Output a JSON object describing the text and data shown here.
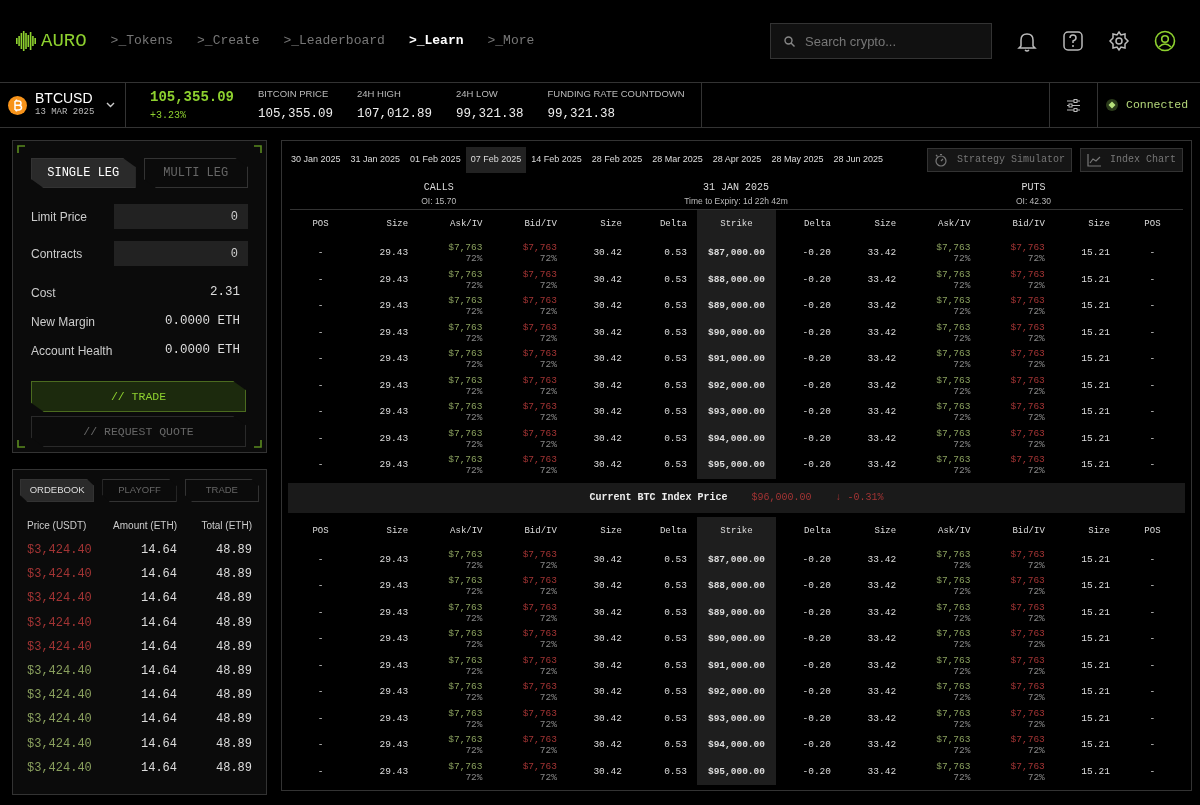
{
  "brand": {
    "name": "AURO"
  },
  "nav": [
    {
      "label": ">_Tokens",
      "selected": false
    },
    {
      "label": ">_Create",
      "selected": false
    },
    {
      "label": ">_Leaderboard",
      "selected": false
    },
    {
      "label": ">_Learn",
      "selected": true
    },
    {
      "label": ">_More",
      "selected": false
    }
  ],
  "search": {
    "placeholder": "Search crypto..."
  },
  "ticker": {
    "symbol": "BTCUSD",
    "date": "13 MAR 2025",
    "price": "105,355.09",
    "change": "+3.23%",
    "stats": [
      {
        "label": "BITCOIN PRICE",
        "value": "105,355.09"
      },
      {
        "label": "24H HIGH",
        "value": "107,012.89"
      },
      {
        "label": "24H LOW",
        "value": "99,321.38"
      },
      {
        "label": "FUNDING RATE COUNTDOWN",
        "value": "99,321.38"
      }
    ]
  },
  "connection": {
    "label": "Connected",
    "connected": true
  },
  "order_form": {
    "modes": [
      {
        "label": "SINGLE LEG",
        "selected": true
      },
      {
        "label": "MULTI LEG",
        "selected": false
      }
    ],
    "inputs": [
      {
        "label": "Limit Price",
        "value": "0"
      },
      {
        "label": "Contracts",
        "value": "0"
      }
    ],
    "summary": [
      {
        "label": "Cost",
        "value": "2.31"
      },
      {
        "label": "New Margin",
        "value": "0.0000 ETH"
      },
      {
        "label": "Account Health",
        "value": "0.0000 ETH"
      }
    ],
    "buttons": [
      {
        "label": "// TRADE",
        "kind": "primary"
      },
      {
        "label": "// REQUEST QUOTE",
        "kind": "secondary"
      }
    ]
  },
  "orderbook": {
    "tabs": [
      {
        "label": "ORDEBOOK",
        "selected": true
      },
      {
        "label": "PLAYOFF",
        "selected": false
      },
      {
        "label": "TRADE",
        "selected": false
      }
    ],
    "columns": [
      "Price (USDT)",
      "Amount (ETH)",
      "Total (ETH)"
    ],
    "rows": [
      {
        "price": "$3,424.40",
        "amount": "14.64",
        "total": "48.89",
        "color": "#a33434"
      },
      {
        "price": "$3,424.40",
        "amount": "14.64",
        "total": "48.89",
        "color": "#a33434"
      },
      {
        "price": "$3,424.40",
        "amount": "14.64",
        "total": "48.89",
        "color": "#a33434"
      },
      {
        "price": "$3,424.40",
        "amount": "14.64",
        "total": "48.89",
        "color": "#a33434"
      },
      {
        "price": "$3,424.40",
        "amount": "14.64",
        "total": "48.89",
        "color": "#a33434"
      },
      {
        "price": "$3,424.40",
        "amount": "14.64",
        "total": "48.89",
        "color": "#8aa05e"
      },
      {
        "price": "$3,424.40",
        "amount": "14.64",
        "total": "48.89",
        "color": "#8aa05e"
      },
      {
        "price": "$3,424.40",
        "amount": "14.64",
        "total": "48.89",
        "color": "#8aa05e"
      },
      {
        "price": "$3,424.40",
        "amount": "14.64",
        "total": "48.89",
        "color": "#8aa05e"
      },
      {
        "price": "$3,424.40",
        "amount": "14.64",
        "total": "48.89",
        "color": "#8aa05e"
      }
    ]
  },
  "options": {
    "expiries": [
      {
        "label": "30 Jan 2025",
        "selected": false
      },
      {
        "label": "31 Jan 2025",
        "selected": false
      },
      {
        "label": "01 Feb 2025",
        "selected": false
      },
      {
        "label": "07 Feb 2025",
        "selected": true
      },
      {
        "label": "14 Feb 2025",
        "selected": false
      },
      {
        "label": "28 Feb 2025",
        "selected": false
      },
      {
        "label": "28 Mar 2025",
        "selected": false
      },
      {
        "label": "28 Apr 2025",
        "selected": false
      },
      {
        "label": "28 May 2025",
        "selected": false
      },
      {
        "label": "28 Jun 2025",
        "selected": false
      }
    ],
    "tools": [
      {
        "label": "Strategy Simulator",
        "kind": "simulator"
      },
      {
        "label": "Index Chart",
        "kind": "chart"
      }
    ],
    "calls": {
      "title": "CALLS",
      "oi": "OI: 15.70"
    },
    "expiry": {
      "date": "31 JAN 2025",
      "time_left": "Time to Expiry: 1d 22h 42m"
    },
    "puts": {
      "title": "PUTS",
      "oi": "OI: 42.30"
    },
    "sections": [
      {
        "columns": [
          "POS",
          "Size",
          "Ask/IV",
          "Bid/IV",
          "Size",
          "Delta",
          "Strike",
          "Delta",
          "Size",
          "Ask/IV",
          "Bid/IV",
          "Size",
          "POS"
        ],
        "rows": [
          {
            "strike": "$87,000.00",
            "call": {
              "pos": "-",
              "size": "29.43",
              "ask": "$7,763",
              "ask_iv": "72%",
              "bid": "$7,763",
              "bid_iv": "72%",
              "size_2": "30.42",
              "delta": "0.53"
            },
            "put": {
              "delta": "-0.20",
              "size": "33.42",
              "ask": "$7,763",
              "ask_iv": "72%",
              "bid": "$7,763",
              "bid_iv": "72%",
              "size_2": "15.21",
              "pos": "-"
            }
          },
          {
            "strike": "$88,000.00",
            "call": {
              "pos": "-",
              "size": "29.43",
              "ask": "$7,763",
              "ask_iv": "72%",
              "bid": "$7,763",
              "bid_iv": "72%",
              "size_2": "30.42",
              "delta": "0.53"
            },
            "put": {
              "delta": "-0.20",
              "size": "33.42",
              "ask": "$7,763",
              "ask_iv": "72%",
              "bid": "$7,763",
              "bid_iv": "72%",
              "size_2": "15.21",
              "pos": "-"
            }
          },
          {
            "strike": "$89,000.00",
            "call": {
              "pos": "-",
              "size": "29.43",
              "ask": "$7,763",
              "ask_iv": "72%",
              "bid": "$7,763",
              "bid_iv": "72%",
              "size_2": "30.42",
              "delta": "0.53"
            },
            "put": {
              "delta": "-0.20",
              "size": "33.42",
              "ask": "$7,763",
              "ask_iv": "72%",
              "bid": "$7,763",
              "bid_iv": "72%",
              "size_2": "15.21",
              "pos": "-"
            }
          },
          {
            "strike": "$90,000.00",
            "call": {
              "pos": "-",
              "size": "29.43",
              "ask": "$7,763",
              "ask_iv": "72%",
              "bid": "$7,763",
              "bid_iv": "72%",
              "size_2": "30.42",
              "delta": "0.53"
            },
            "put": {
              "delta": "-0.20",
              "size": "33.42",
              "ask": "$7,763",
              "ask_iv": "72%",
              "bid": "$7,763",
              "bid_iv": "72%",
              "size_2": "15.21",
              "pos": "-"
            }
          },
          {
            "strike": "$91,000.00",
            "call": {
              "pos": "-",
              "size": "29.43",
              "ask": "$7,763",
              "ask_iv": "72%",
              "bid": "$7,763",
              "bid_iv": "72%",
              "size_2": "30.42",
              "delta": "0.53"
            },
            "put": {
              "delta": "-0.20",
              "size": "33.42",
              "ask": "$7,763",
              "ask_iv": "72%",
              "bid": "$7,763",
              "bid_iv": "72%",
              "size_2": "15.21",
              "pos": "-"
            }
          },
          {
            "strike": "$92,000.00",
            "call": {
              "pos": "-",
              "size": "29.43",
              "ask": "$7,763",
              "ask_iv": "72%",
              "bid": "$7,763",
              "bid_iv": "72%",
              "size_2": "30.42",
              "delta": "0.53"
            },
            "put": {
              "delta": "-0.20",
              "size": "33.42",
              "ask": "$7,763",
              "ask_iv": "72%",
              "bid": "$7,763",
              "bid_iv": "72%",
              "size_2": "15.21",
              "pos": "-"
            }
          },
          {
            "strike": "$93,000.00",
            "call": {
              "pos": "-",
              "size": "29.43",
              "ask": "$7,763",
              "ask_iv": "72%",
              "bid": "$7,763",
              "bid_iv": "72%",
              "size_2": "30.42",
              "delta": "0.53"
            },
            "put": {
              "delta": "-0.20",
              "size": "33.42",
              "ask": "$7,763",
              "ask_iv": "72%",
              "bid": "$7,763",
              "bid_iv": "72%",
              "size_2": "15.21",
              "pos": "-"
            }
          },
          {
            "strike": "$94,000.00",
            "call": {
              "pos": "-",
              "size": "29.43",
              "ask": "$7,763",
              "ask_iv": "72%",
              "bid": "$7,763",
              "bid_iv": "72%",
              "size_2": "30.42",
              "delta": "0.53"
            },
            "put": {
              "delta": "-0.20",
              "size": "33.42",
              "ask": "$7,763",
              "ask_iv": "72%",
              "bid": "$7,763",
              "bid_iv": "72%",
              "size_2": "15.21",
              "pos": "-"
            }
          },
          {
            "strike": "$95,000.00",
            "call": {
              "pos": "-",
              "size": "29.43",
              "ask": "$7,763",
              "ask_iv": "72%",
              "bid": "$7,763",
              "bid_iv": "72%",
              "size_2": "30.42",
              "delta": "0.53"
            },
            "put": {
              "delta": "-0.20",
              "size": "33.42",
              "ask": "$7,763",
              "ask_iv": "72%",
              "bid": "$7,763",
              "bid_iv": "72%",
              "size_2": "15.21",
              "pos": "-"
            }
          }
        ]
      },
      {
        "columns": [
          "POS",
          "Size",
          "Ask/IV",
          "Bid/IV",
          "Size",
          "Delta",
          "Strike",
          "Delta",
          "Size",
          "Ask/IV",
          "Bid/IV",
          "Size",
          "POS"
        ],
        "rows": [
          {
            "strike": "$87,000.00",
            "call": {
              "pos": "-",
              "size": "29.43",
              "ask": "$7,763",
              "ask_iv": "72%",
              "bid": "$7,763",
              "bid_iv": "72%",
              "size_2": "30.42",
              "delta": "0.53"
            },
            "put": {
              "delta": "-0.20",
              "size": "33.42",
              "ask": "$7,763",
              "ask_iv": "72%",
              "bid": "$7,763",
              "bid_iv": "72%",
              "size_2": "15.21",
              "pos": "-"
            }
          },
          {
            "strike": "$88,000.00",
            "call": {
              "pos": "-",
              "size": "29.43",
              "ask": "$7,763",
              "ask_iv": "72%",
              "bid": "$7,763",
              "bid_iv": "72%",
              "size_2": "30.42",
              "delta": "0.53"
            },
            "put": {
              "delta": "-0.20",
              "size": "33.42",
              "ask": "$7,763",
              "ask_iv": "72%",
              "bid": "$7,763",
              "bid_iv": "72%",
              "size_2": "15.21",
              "pos": "-"
            }
          },
          {
            "strike": "$89,000.00",
            "call": {
              "pos": "-",
              "size": "29.43",
              "ask": "$7,763",
              "ask_iv": "72%",
              "bid": "$7,763",
              "bid_iv": "72%",
              "size_2": "30.42",
              "delta": "0.53"
            },
            "put": {
              "delta": "-0.20",
              "size": "33.42",
              "ask": "$7,763",
              "ask_iv": "72%",
              "bid": "$7,763",
              "bid_iv": "72%",
              "size_2": "15.21",
              "pos": "-"
            }
          },
          {
            "strike": "$90,000.00",
            "call": {
              "pos": "-",
              "size": "29.43",
              "ask": "$7,763",
              "ask_iv": "72%",
              "bid": "$7,763",
              "bid_iv": "72%",
              "size_2": "30.42",
              "delta": "0.53"
            },
            "put": {
              "delta": "-0.20",
              "size": "33.42",
              "ask": "$7,763",
              "ask_iv": "72%",
              "bid": "$7,763",
              "bid_iv": "72%",
              "size_2": "15.21",
              "pos": "-"
            }
          },
          {
            "strike": "$91,000.00",
            "call": {
              "pos": "-",
              "size": "29.43",
              "ask": "$7,763",
              "ask_iv": "72%",
              "bid": "$7,763",
              "bid_iv": "72%",
              "size_2": "30.42",
              "delta": "0.53"
            },
            "put": {
              "delta": "-0.20",
              "size": "33.42",
              "ask": "$7,763",
              "ask_iv": "72%",
              "bid": "$7,763",
              "bid_iv": "72%",
              "size_2": "15.21",
              "pos": "-"
            }
          },
          {
            "strike": "$92,000.00",
            "call": {
              "pos": "-",
              "size": "29.43",
              "ask": "$7,763",
              "ask_iv": "72%",
              "bid": "$7,763",
              "bid_iv": "72%",
              "size_2": "30.42",
              "delta": "0.53"
            },
            "put": {
              "delta": "-0.20",
              "size": "33.42",
              "ask": "$7,763",
              "ask_iv": "72%",
              "bid": "$7,763",
              "bid_iv": "72%",
              "size_2": "15.21",
              "pos": "-"
            }
          },
          {
            "strike": "$93,000.00",
            "call": {
              "pos": "-",
              "size": "29.43",
              "ask": "$7,763",
              "ask_iv": "72%",
              "bid": "$7,763",
              "bid_iv": "72%",
              "size_2": "30.42",
              "delta": "0.53"
            },
            "put": {
              "delta": "-0.20",
              "size": "33.42",
              "ask": "$7,763",
              "ask_iv": "72%",
              "bid": "$7,763",
              "bid_iv": "72%",
              "size_2": "15.21",
              "pos": "-"
            }
          },
          {
            "strike": "$94,000.00",
            "call": {
              "pos": "-",
              "size": "29.43",
              "ask": "$7,763",
              "ask_iv": "72%",
              "bid": "$7,763",
              "bid_iv": "72%",
              "size_2": "30.42",
              "delta": "0.53"
            },
            "put": {
              "delta": "-0.20",
              "size": "33.42",
              "ask": "$7,763",
              "ask_iv": "72%",
              "bid": "$7,763",
              "bid_iv": "72%",
              "size_2": "15.21",
              "pos": "-"
            }
          },
          {
            "strike": "$95,000.00",
            "call": {
              "pos": "-",
              "size": "29.43",
              "ask": "$7,763",
              "ask_iv": "72%",
              "bid": "$7,763",
              "bid_iv": "72%",
              "size_2": "30.42",
              "delta": "0.53"
            },
            "put": {
              "delta": "-0.20",
              "size": "33.42",
              "ask": "$7,763",
              "ask_iv": "72%",
              "bid": "$7,763",
              "bid_iv": "72%",
              "size_2": "15.21",
              "pos": "-"
            }
          }
        ]
      }
    ],
    "index_price": {
      "label": "Current BTC Index Price",
      "value": "$96,000.00",
      "change": "↓ -0.31%"
    }
  }
}
